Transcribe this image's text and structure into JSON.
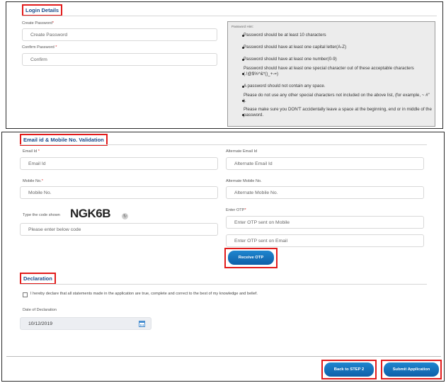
{
  "login": {
    "title": "Login Details",
    "create_password_label": "Create Password",
    "create_password_placeholder": "Create Password",
    "confirm_password_label": "Confirm Password",
    "confirm_password_placeholder": "Confirm",
    "required_mark": "*",
    "hint": {
      "title": "Password Hint:",
      "items": [
        "Password should be at least 10 characters",
        "Password should have at least one capital letter(A-Z)",
        "Password should have at least one number(0-9)",
        "Password should have at least one special character out of these acceptable characters (.!@$%^&*()_+-=)",
        "A password should not contain any space.",
        "Please do not use any other special characters not included on the above list, (for example, ~ #\" ).",
        "Please make sure you DON'T accidentally leave a space at the beginning, end or in middle of the password."
      ]
    }
  },
  "validation": {
    "title": "Email id & Mobile No. Validation",
    "email_label": "Email Id",
    "email_placeholder": "Email Id",
    "alt_email_label": "Alternate Email Id",
    "alt_email_placeholder": "Alternate Email Id",
    "mobile_label": "Mobile No.",
    "mobile_placeholder": "Mobile No.",
    "alt_mobile_label": "Alternate Mobile No.",
    "alt_mobile_placeholder": "Alternate Mobile No.",
    "captcha_label": "Type the code shown",
    "captcha_code": "NGK6B",
    "refresh_glyph": "↻",
    "captcha_placeholder": "Please enter below code",
    "otp_label": "Enter OTP",
    "otp_mobile_placeholder": "Enter OTP sent on Mobile",
    "otp_email_placeholder": "Enter OTP sent on Email",
    "receive_otp_label": "Receive OTP"
  },
  "declaration": {
    "title": "Declaration",
    "statement": "I hereby declare that all statements made in the application are true, complete and correct to the best of my knowledge and belief.",
    "date_label": "Date of Declaration",
    "date_value": "10/12/2019"
  },
  "actions": {
    "back_label": "Back to STEP 2",
    "submit_label": "Submit Application"
  },
  "colors": {
    "accent": "#1a4a8a",
    "button": "#1475bf",
    "highlight": "#e21b1b"
  }
}
